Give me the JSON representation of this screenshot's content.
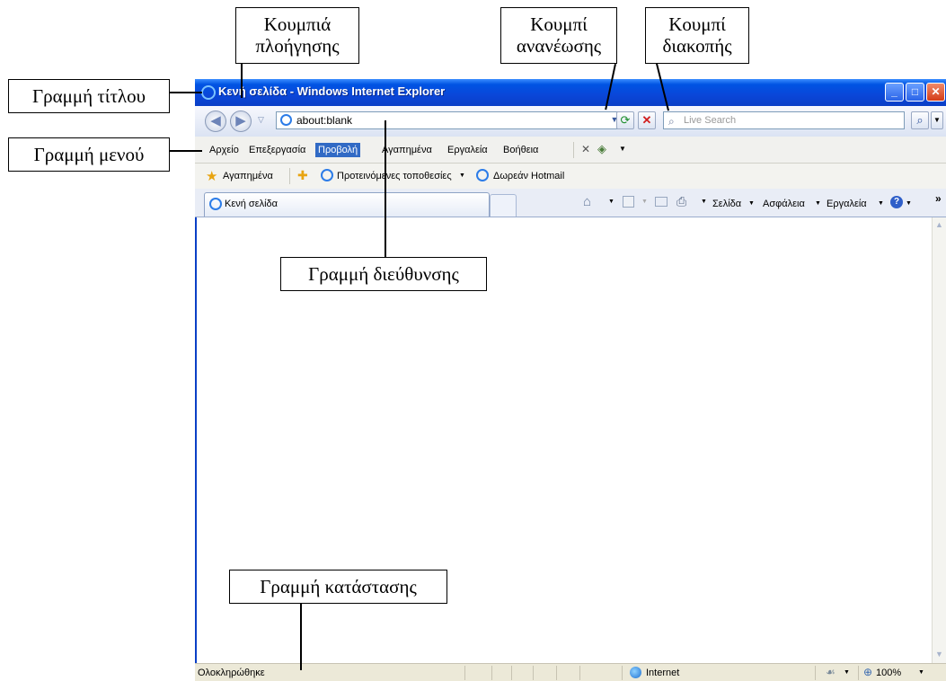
{
  "window": {
    "title": "Κενή σελίδα - Windows Internet Explorer",
    "controls": {
      "minimize": "_",
      "maximize": "□",
      "close": "✕"
    }
  },
  "navbar": {
    "address": "about:blank",
    "search_placeholder": "Live Search"
  },
  "menu": [
    "Αρχείο",
    "Επεξεργασία",
    "Προβολή",
    "Αγαπημένα",
    "Εργαλεία",
    "Βοήθεια"
  ],
  "favorites_bar": {
    "favorites": "Αγαπημένα",
    "suggested_sites": "Προτεινόμενες τοποθεσίες",
    "hotmail": "Δωρεάν Hotmail"
  },
  "tab": {
    "label": "Κενή σελίδα"
  },
  "command_bar": {
    "page": "Σελίδα",
    "safety": "Ασφάλεια",
    "tools": "Εργαλεία",
    "more": "»"
  },
  "status": {
    "text": "Ολοκληρώθηκε",
    "zone": "Internet",
    "zoom": "100%"
  },
  "callouts": {
    "nav_buttons_1": "Κουμπιά",
    "nav_buttons_2": "πλοήγησης",
    "refresh_1": "Κουμπί",
    "refresh_2": "ανανέωσης",
    "stop_1": "Κουμπί",
    "stop_2": "διακοπής",
    "title_bar": "Γραμμή τίτλου",
    "menu_bar": "Γραμμή μενού",
    "address_bar": "Γραμμή διεύθυνσης",
    "status_bar": "Γραμμή κατάστασης"
  },
  "colors": {
    "titlebar": "#0a46d9",
    "menu_highlight": "#316ac5"
  }
}
